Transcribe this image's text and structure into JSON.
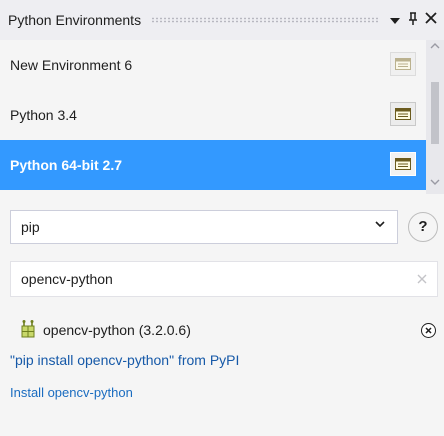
{
  "panel": {
    "title": "Python Environments",
    "dropdown_glyph": "▾",
    "pin_glyph": "⊥",
    "close_glyph": "✕"
  },
  "environments": [
    {
      "name": "New Environment 6",
      "icon": "environment-window-icon",
      "selected": false
    },
    {
      "name": "Python 3.4",
      "icon": "environment-window-icon",
      "selected": false
    },
    {
      "name": "Python 64-bit 2.7",
      "icon": "environment-window-icon",
      "selected": true
    }
  ],
  "view_selector": {
    "value": "pip",
    "caret": "⌄"
  },
  "help_label": "?",
  "package_search": {
    "value": "opencv-python",
    "clear_glyph": "✕"
  },
  "result": {
    "package_label": "opencv-python (3.2.0.6)",
    "remove_glyph": "✕",
    "pip_install_link": "\"pip install opencv-python\" from PyPI",
    "install_link": "Install opencv-python"
  },
  "colors": {
    "selection": "#3399ff",
    "link": "#1a5fb4",
    "panel_bg": "#f5f5f5"
  }
}
